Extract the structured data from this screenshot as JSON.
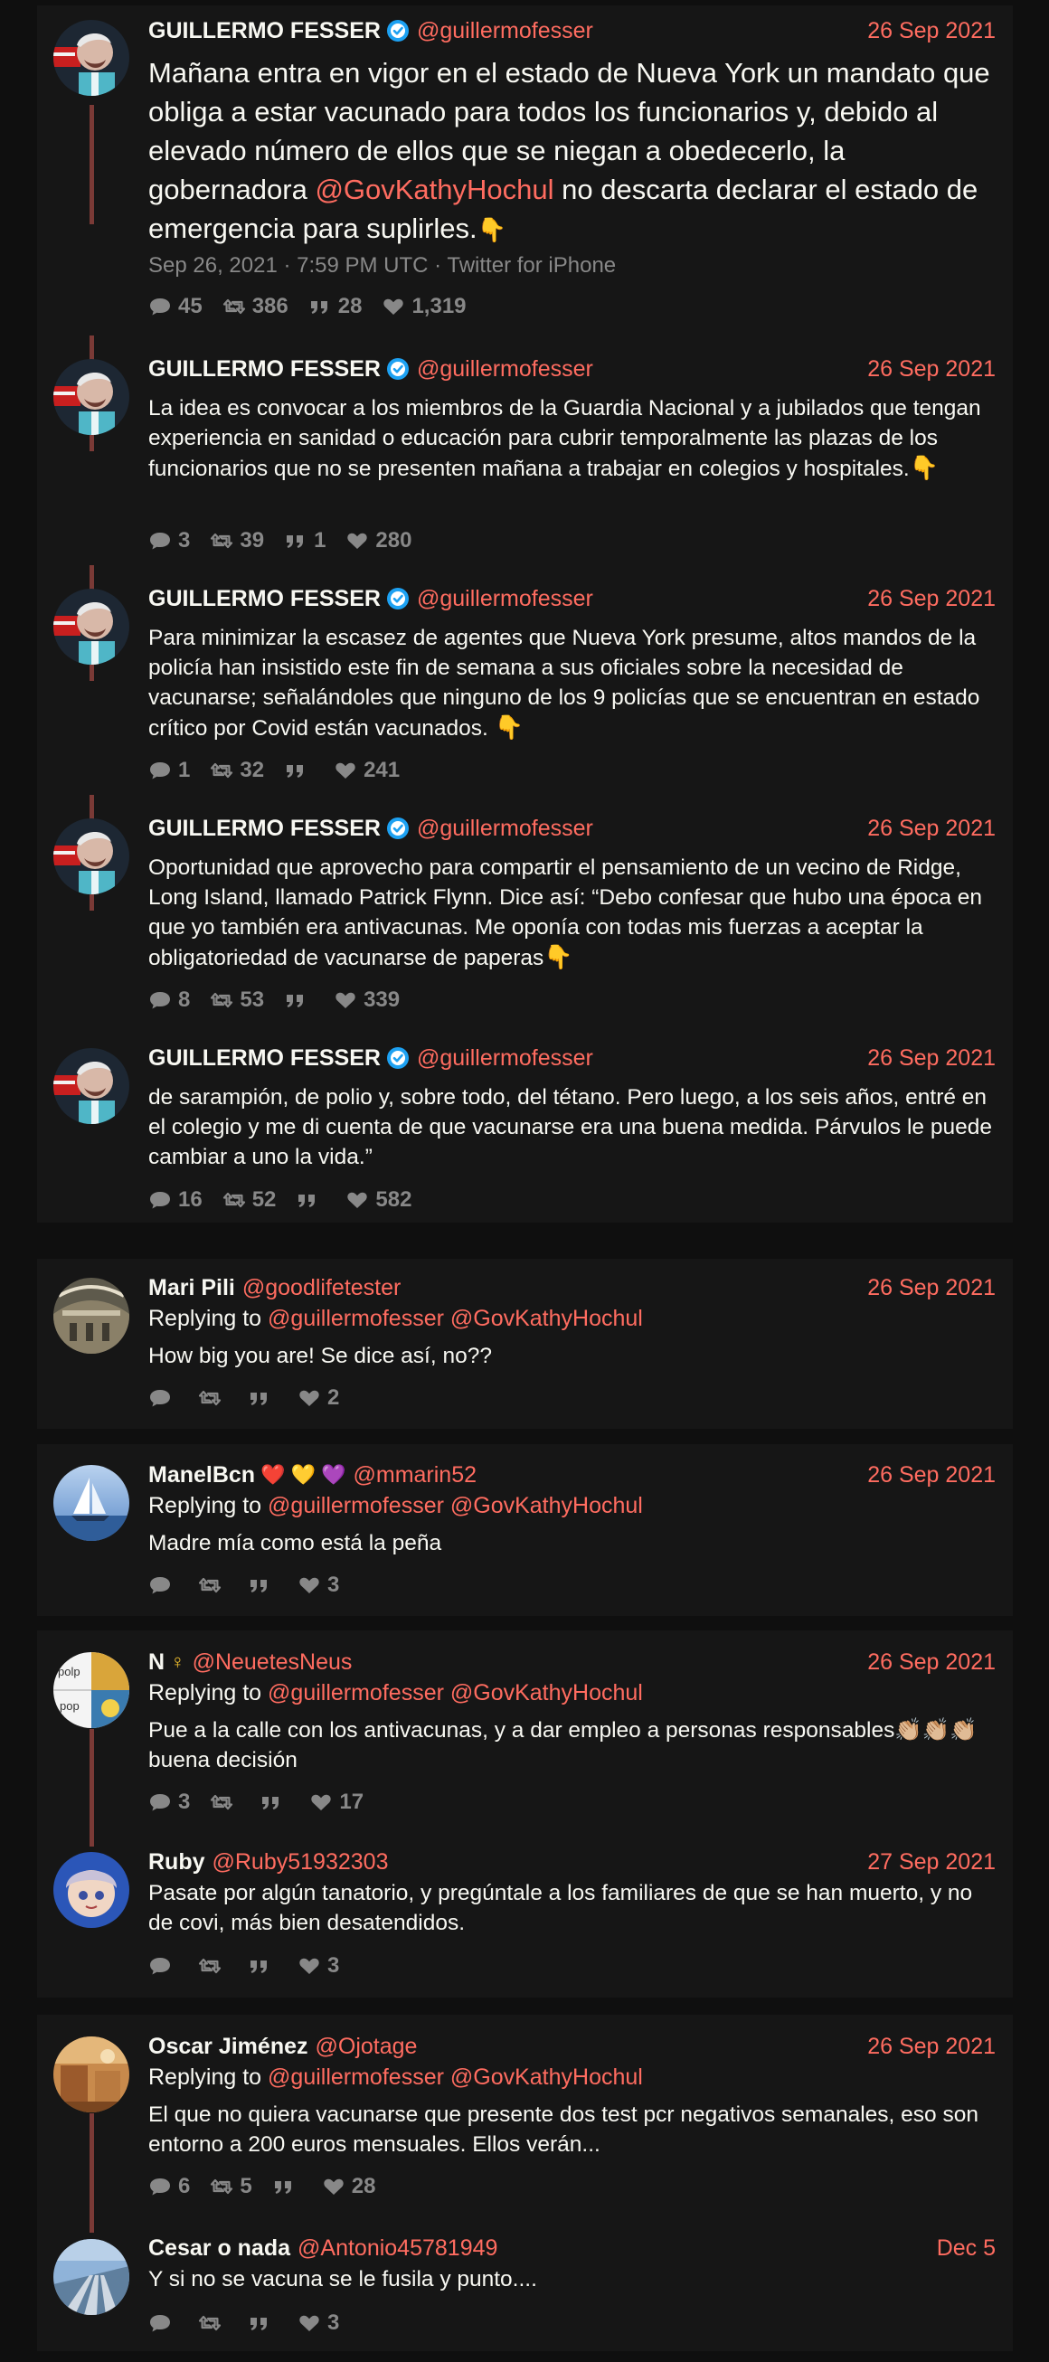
{
  "colors": {
    "background": "#0f0f0f",
    "card": "#161616",
    "accent": "#ff6c60",
    "muted": "#888888",
    "thread_line": "#7a3a36",
    "verified": "#1da1f2"
  },
  "main_thread": [
    {
      "fullname": "GUILLERMO FESSER",
      "verified": true,
      "username": "@guillermofesser",
      "date": "26 Sep 2021",
      "text_pre": "Mañana entra en vigor en el estado de Nueva York un mandato que obliga a estar vacunado para todos los funcionarios y, debido al elevado número de ellos que se niegan a obedecerlo, la gobernadora ",
      "mention": "@GovKathyHochul",
      "text_post": " no descarta declarar el estado de emergencia para suplirles.",
      "emoji": "👇",
      "published": "Sep 26, 2021 · 7:59 PM UTC · Twitter for iPhone",
      "stats": {
        "comments": "45",
        "retweets": "386",
        "quotes": "28",
        "likes": "1,319"
      }
    },
    {
      "fullname": "GUILLERMO FESSER",
      "verified": true,
      "username": "@guillermofesser",
      "date": "26 Sep 2021",
      "text": "La idea es convocar a los miembros de la Guardia Nacional y a jubilados que tengan experiencia en sanidad o educación para cubrir temporalmente las plazas de los funcionarios que no se presenten mañana a trabajar en colegios y hospitales.",
      "emoji": "👇",
      "stats": {
        "comments": "3",
        "retweets": "39",
        "quotes": "1",
        "likes": "280"
      }
    },
    {
      "fullname": "GUILLERMO FESSER",
      "verified": true,
      "username": "@guillermofesser",
      "date": "26 Sep 2021",
      "text": "Para minimizar la escasez de agentes que Nueva York presume, altos mandos de la policía han insistido este fin de semana a sus oficiales sobre la necesidad de vacunarse; señalándoles que ninguno de los 9 policías que se encuentran en estado crítico por Covid están vacunados. ",
      "emoji": "👇",
      "stats": {
        "comments": "1",
        "retweets": "32",
        "quotes": "",
        "likes": "241"
      }
    },
    {
      "fullname": "GUILLERMO FESSER",
      "verified": true,
      "username": "@guillermofesser",
      "date": "26 Sep 2021",
      "text": "Oportunidad que aprovecho para compartir el pensamiento de un vecino de Ridge, Long Island, llamado Patrick Flynn. Dice así: “Debo confesar que hubo una época en que yo también era antivacunas. Me oponía con todas mis fuerzas a aceptar la obligatoriedad de vacunarse de paperas",
      "emoji": "👇",
      "stats": {
        "comments": "8",
        "retweets": "53",
        "quotes": "",
        "likes": "339"
      }
    },
    {
      "fullname": "GUILLERMO FESSER",
      "verified": true,
      "username": "@guillermofesser",
      "date": "26 Sep 2021",
      "text": "de sarampión, de polio y, sobre todo, del tétano. Pero luego, a los seis años, entré en el colegio y me di cuenta de que vacunarse era una buena medida. Párvulos le puede cambiar a uno la vida.”",
      "emoji": "",
      "stats": {
        "comments": "16",
        "retweets": "52",
        "quotes": "",
        "likes": "582"
      }
    }
  ],
  "replies": [
    {
      "fullname": "Mari Pili",
      "username": "@goodlifetester",
      "date": "26 Sep 2021",
      "replying_label": "Replying to",
      "replying_to": [
        "@guillermofesser",
        "@GovKathyHochul"
      ],
      "text": "How big you are! Se dice así, no??",
      "stats": {
        "comments": "",
        "retweets": "",
        "quotes": "",
        "likes": "2"
      }
    },
    {
      "fullname": "ManelBcn",
      "name_emoji": "❤️ 💛 💜",
      "username": "@mmarin52",
      "date": "26 Sep 2021",
      "replying_label": "Replying to",
      "replying_to": [
        "@guillermofesser",
        "@GovKathyHochul"
      ],
      "text": "Madre mía como está la peña",
      "stats": {
        "comments": "",
        "retweets": "",
        "quotes": "",
        "likes": "3"
      }
    },
    {
      "fullname": "N",
      "name_emoji": "♀",
      "username": "@NeuetesNeus",
      "date": "26 Sep 2021",
      "replying_label": "Replying to",
      "replying_to": [
        "@guillermofesser",
        "@GovKathyHochul"
      ],
      "text": "Pue a la calle con los antivacunas, y a dar empleo a personas responsables👏🏼👏🏼👏🏼 buena decisión",
      "avatar_text": [
        "polp",
        "pop"
      ],
      "stats": {
        "comments": "3",
        "retweets": "",
        "quotes": "",
        "likes": "17"
      }
    },
    {
      "fullname": "Ruby",
      "username": "@Ruby51932303",
      "date": "27 Sep 2021",
      "text": "Pasate por algún tanatorio, y pregúntale a los familiares de que se han muerto, y no de covi, más bien desatendidos.",
      "stats": {
        "comments": "",
        "retweets": "",
        "quotes": "",
        "likes": "3"
      }
    },
    {
      "fullname": "Oscar Jiménez",
      "username": "@Ojotage",
      "date": "26 Sep 2021",
      "replying_label": "Replying to",
      "replying_to": [
        "@guillermofesser",
        "@GovKathyHochul"
      ],
      "text": "El que no quiera vacunarse que presente dos test pcr negativos semanales, eso son entorno a 200 euros mensuales. Ellos verán...",
      "stats": {
        "comments": "6",
        "retweets": "5",
        "quotes": "",
        "likes": "28"
      }
    },
    {
      "fullname": "Cesar o nada",
      "username": "@Antonio45781949",
      "date": "Dec 5",
      "text": "Y si no se vacuna se le fusila y punto....",
      "stats": {
        "comments": "",
        "retweets": "",
        "quotes": "",
        "likes": "3"
      }
    }
  ],
  "icons": {
    "comment": "comment-icon",
    "retweet": "retweet-icon",
    "quote": "quote-icon",
    "like": "heart-icon",
    "verified": "verified-badge-icon"
  }
}
